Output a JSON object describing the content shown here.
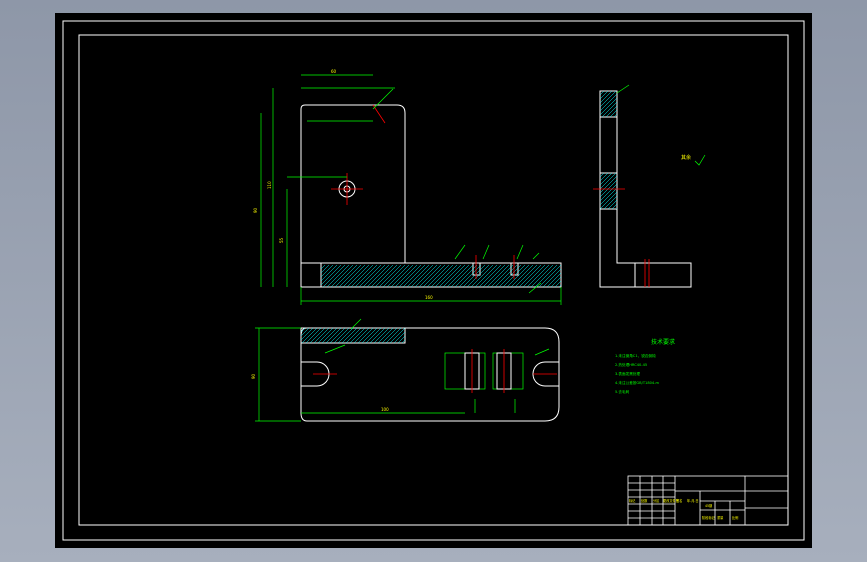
{
  "drawing": {
    "tech_title": "技术要求",
    "tech_lines": [
      "1.未注倒角C1，锐边倒钝",
      "2.热处理HRC40-45",
      "3.表面发黑处理",
      "4.未注公差按GB/T1804-m",
      "5.去毛刺"
    ],
    "roughness_note": "其余",
    "title_block": {
      "cells": [
        "标记",
        "处数",
        "分区",
        "更改文件号",
        "签名",
        "年.月.日"
      ],
      "material": "45钢",
      "scale_labels": [
        "阶段标记",
        "重量",
        "比例"
      ]
    }
  },
  "colors": {
    "background": "#000000",
    "frame": "#ffffff",
    "dimension": "#00ff00",
    "centerline": "#ff0000",
    "text": "#ffff00",
    "hatch": "#00ffff"
  }
}
